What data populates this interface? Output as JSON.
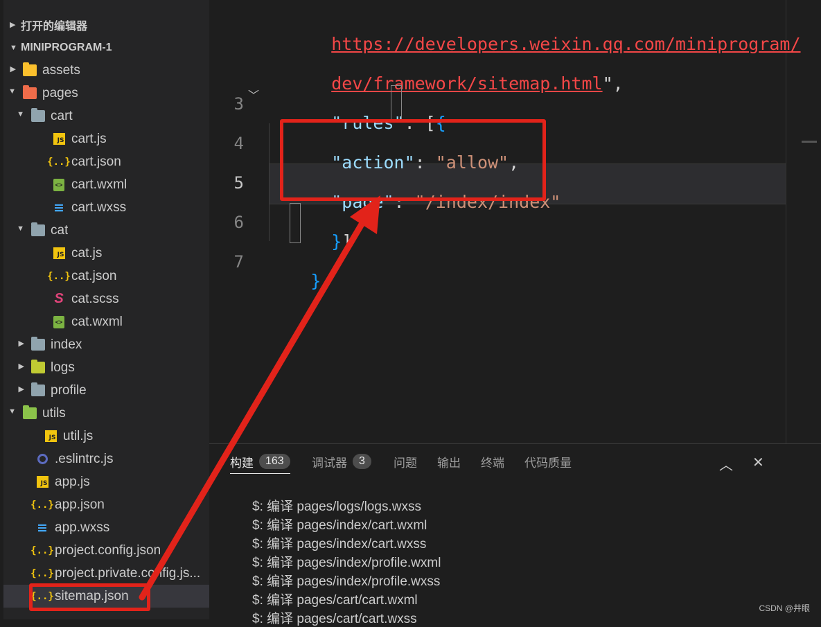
{
  "sidebar": {
    "open_editors_label": "打开的编辑器",
    "project_label": "MINIPROGRAM-1",
    "items": [
      {
        "label": "assets",
        "icon": "folder-assets-icon",
        "kind": "folder"
      },
      {
        "label": "pages",
        "icon": "folder-pages-icon",
        "kind": "folder-open"
      },
      {
        "label": "cart",
        "icon": "folder-open-icon",
        "kind": "folder-open"
      },
      {
        "label": "cart.js",
        "icon": "js-file-icon",
        "kind": "js"
      },
      {
        "label": "cart.json",
        "icon": "json-file-icon",
        "kind": "json"
      },
      {
        "label": "cart.wxml",
        "icon": "wxml-file-icon",
        "kind": "wxml"
      },
      {
        "label": "cart.wxss",
        "icon": "css-file-icon",
        "kind": "css"
      },
      {
        "label": "cat",
        "icon": "folder-open-icon",
        "kind": "folder-open"
      },
      {
        "label": "cat.js",
        "icon": "js-file-icon",
        "kind": "js"
      },
      {
        "label": "cat.json",
        "icon": "json-file-icon",
        "kind": "json"
      },
      {
        "label": "cat.scss",
        "icon": "scss-file-icon",
        "kind": "scss"
      },
      {
        "label": "cat.wxml",
        "icon": "wxml-file-icon",
        "kind": "wxml"
      },
      {
        "label": "index",
        "icon": "folder-icon",
        "kind": "folder"
      },
      {
        "label": "logs",
        "icon": "folder-logs-icon",
        "kind": "folder"
      },
      {
        "label": "profile",
        "icon": "folder-icon",
        "kind": "folder"
      },
      {
        "label": "utils",
        "icon": "folder-utils-icon",
        "kind": "folder-open"
      },
      {
        "label": "util.js",
        "icon": "js-file-icon",
        "kind": "js"
      },
      {
        "label": ".eslintrc.js",
        "icon": "eslint-file-icon",
        "kind": "eslint"
      },
      {
        "label": "app.js",
        "icon": "js-file-icon",
        "kind": "js"
      },
      {
        "label": "app.json",
        "icon": "json-file-icon",
        "kind": "json"
      },
      {
        "label": "app.wxss",
        "icon": "css-file-icon",
        "kind": "css"
      },
      {
        "label": "project.config.json",
        "icon": "json-file-icon",
        "kind": "json"
      },
      {
        "label": "project.private.config.js...",
        "icon": "json-file-icon",
        "kind": "json"
      },
      {
        "label": "sitemap.json",
        "icon": "json-file-icon",
        "kind": "json"
      }
    ]
  },
  "editor": {
    "url_line1": "https://developers.weixin.qq.com/miniprogram/",
    "url_line2": "dev/framework/sitemap.html",
    "url_line2_tail": "\",",
    "line_numbers": [
      "3",
      "4",
      "5",
      "6",
      "7"
    ],
    "rules_key": "\"rules\"",
    "rules_rest": ": [",
    "brace_open": "{",
    "action_key": "\"action\"",
    "colon": ": ",
    "action_value": "\"allow\"",
    "comma": ",",
    "page_key": "\"page\"",
    "page_value": "\"/index/index\"",
    "close_brace": "}",
    "close_bracket": "]",
    "final_brace": "}"
  },
  "panel": {
    "tabs": [
      {
        "label": "构建",
        "badge": "163"
      },
      {
        "label": "调试器",
        "badge": "3"
      },
      {
        "label": "问题",
        "badge": ""
      },
      {
        "label": "输出",
        "badge": ""
      },
      {
        "label": "终端",
        "badge": ""
      },
      {
        "label": "代码质量",
        "badge": ""
      }
    ],
    "output": [
      "$: 编译 pages/logs/logs.wxss",
      "$: 编译 pages/index/cart.wxml",
      "$: 编译 pages/index/cart.wxss",
      "$: 编译 pages/index/profile.wxml",
      "$: 编译 pages/index/profile.wxss",
      "$: 编译 pages/cart/cart.wxml",
      "$: 编译 pages/cart/cart.wxss"
    ]
  },
  "watermark": "CSDN @井眼",
  "colors": {
    "annotation_red": "#e2231a",
    "string": "#ce9178",
    "key": "#9cdcfe"
  }
}
